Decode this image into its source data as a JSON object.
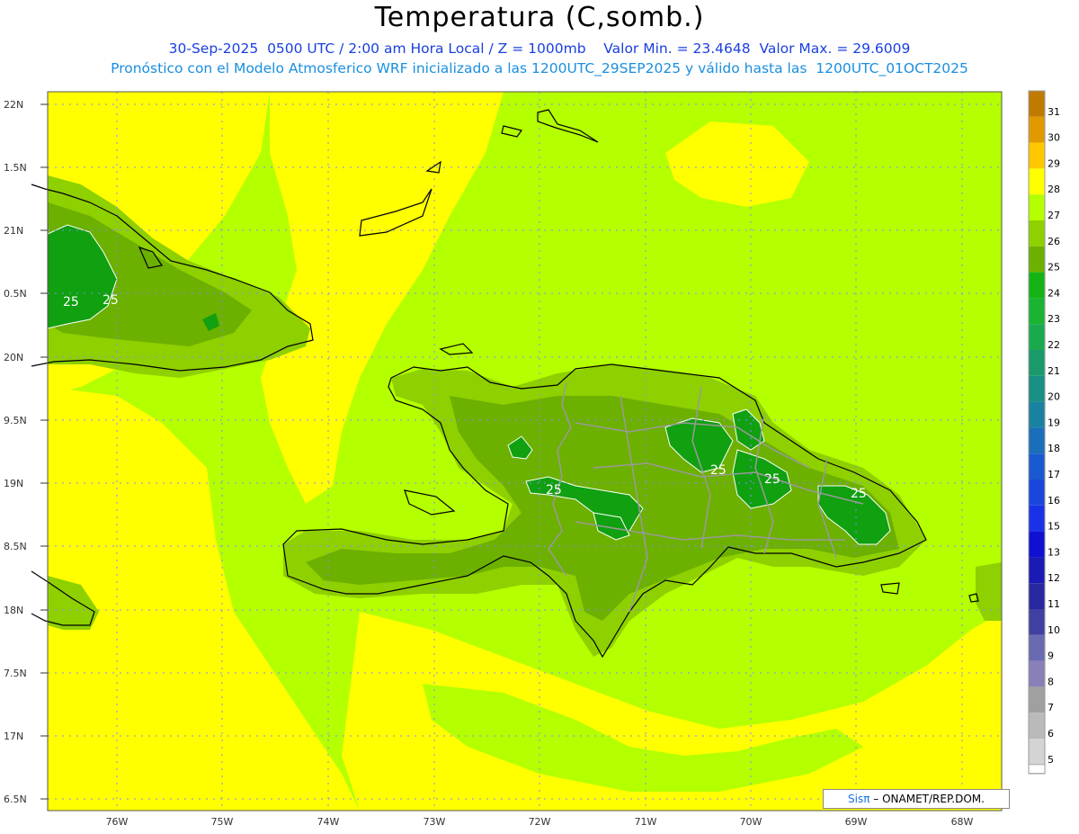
{
  "header": {
    "title": "Temperatura (C,somb.)",
    "subtitle1": "30-Sep-2025  0500 UTC / 2:00 am Hora Local / Z = 1000mb    Valor Min. = 23.4648  Valor Max. = 29.6009",
    "subtitle2": "Pronóstico con el Modelo Atmosferico WRF inicializado a las 1200UTC_29SEP2025 y válido hasta las  1200UTC_01OCT2025"
  },
  "map": {
    "lat_labels": [
      "22N",
      "1.5N",
      "21N",
      "0.5N",
      "20N",
      "9.5N",
      "19N",
      "8.5N",
      "18N",
      "7.5N",
      "17N",
      "6.5N"
    ],
    "lon_labels": [
      "76W",
      "75W",
      "74W",
      "73W",
      "72W",
      "71W",
      "70W",
      "69W",
      "68W"
    ],
    "contour_labels": [
      "25",
      "25",
      "25",
      "25",
      "25",
      "25"
    ],
    "colors": {
      "bg_yellow": "#ffff00",
      "green_yellow": "#b4ff00",
      "light_green": "#8ed000",
      "mid_green": "#6cb000",
      "green": "#2dbb1a",
      "dark_green": "#10a010",
      "coast": "#000000",
      "border": "#9a9a9a"
    }
  },
  "colorbar": {
    "levels": [
      "31",
      "30",
      "29",
      "28",
      "27",
      "26",
      "25",
      "24",
      "23",
      "22",
      "21",
      "20",
      "19",
      "18",
      "17",
      "16",
      "15",
      "13",
      "12",
      "11",
      "10",
      "9",
      "8",
      "7",
      "6",
      "5"
    ],
    "colors": [
      "#c07a00",
      "#e09a00",
      "#ffc800",
      "#ffff00",
      "#b4ff00",
      "#8ed000",
      "#6cb000",
      "#14b414",
      "#18b432",
      "#1aaa4e",
      "#1a9a6a",
      "#189084",
      "#1a82a0",
      "#1a6eba",
      "#1a5ad0",
      "#1a46dc",
      "#1a32e6",
      "#1010d0",
      "#1a1ab4",
      "#2828a0",
      "#4040a0",
      "#6a6ab0",
      "#8a80b8",
      "#a0a0a0",
      "#bababa",
      "#d4d4d4"
    ]
  },
  "credit": {
    "brand": "Sisπ",
    "org": "– ONAMET/REP.DOM."
  }
}
